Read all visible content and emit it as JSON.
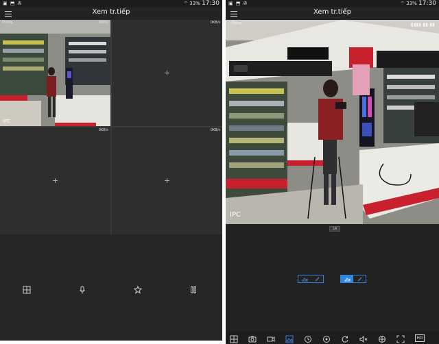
{
  "left_screen": {
    "status": {
      "time": "17:30",
      "battery": "33%"
    },
    "title": "Xem tr.tiếp",
    "channels": [
      {
        "name": "Phòng",
        "rate": "0KB/s",
        "overlay": "IPC"
      },
      {
        "rate": "0KB/s",
        "plus": "+"
      },
      {
        "rate": "0KB/s",
        "plus": "+"
      },
      {
        "rate": "0KB/s",
        "plus": "+"
      }
    ],
    "bottom_icons": [
      "layout-icon",
      "microphone-icon",
      "star-icon",
      "pause-icon"
    ]
  },
  "right_screen": {
    "status": {
      "time": "17:30",
      "battery": "33%"
    },
    "title": "Xem tr.tiếp",
    "video": {
      "camera_name": "Phòng",
      "overlay": "IPC"
    },
    "speed_label": "1/8",
    "controls": [
      {
        "name": "image-adjust-icon",
        "active": false
      },
      {
        "name": "pen-icon",
        "active": false
      },
      {
        "name": "image-adjust-icon",
        "active": true
      },
      {
        "name": "pen-icon",
        "active": false
      }
    ],
    "toolbar_icons": [
      "layout-icon",
      "camera-icon",
      "record-icon",
      "image-icon",
      "history-icon",
      "ptz-icon",
      "rotate-icon",
      "mute-icon",
      "fisheye-icon",
      "fullscreen-icon",
      "hd-icon"
    ],
    "hd_label": "HD"
  },
  "colors": {
    "accent": "#3a7fd0",
    "background": "#232323",
    "grid_line": "#3a3a3a",
    "store_red": "#c8202c"
  }
}
